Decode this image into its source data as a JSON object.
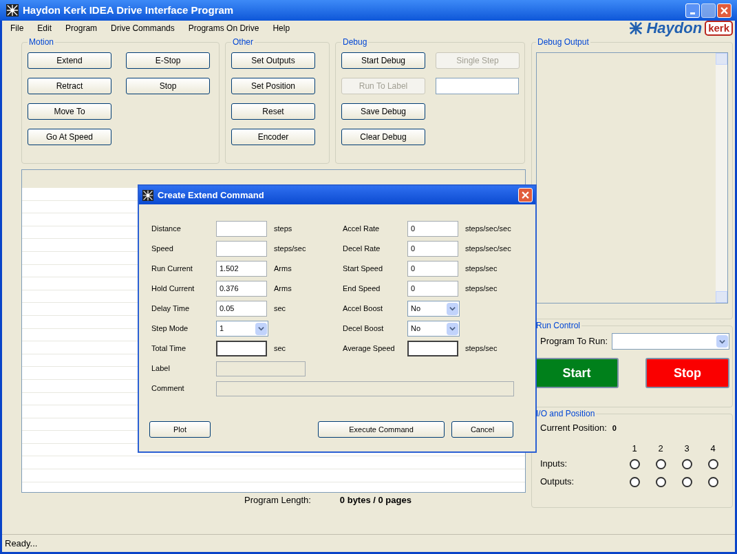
{
  "window": {
    "title": "Haydon Kerk IDEA Drive Interface Program"
  },
  "menu": [
    "File",
    "Edit",
    "Program",
    "Drive Commands",
    "Programs On Drive",
    "Help"
  ],
  "logo": {
    "brand": "Haydon",
    "badge": "kerk"
  },
  "motion": {
    "title": "Motion",
    "buttons": [
      {
        "label": "Extend",
        "disabled": false
      },
      {
        "label": "E-Stop",
        "disabled": false
      },
      {
        "label": "Retract",
        "disabled": false
      },
      {
        "label": "Stop",
        "disabled": false
      },
      {
        "label": "Move To",
        "disabled": false
      },
      {
        "kind": "empty"
      },
      {
        "label": "Go At Speed",
        "disabled": false
      }
    ]
  },
  "other": {
    "title": "Other",
    "buttons": [
      {
        "label": "Set Outputs",
        "disabled": false
      },
      {
        "label": "Set Position",
        "disabled": false
      },
      {
        "label": "Reset",
        "disabled": false
      },
      {
        "label": "Encoder",
        "disabled": false
      }
    ]
  },
  "debug": {
    "title": "Debug",
    "buttons": [
      {
        "label": "Start Debug",
        "disabled": false
      },
      {
        "label": "Single Step",
        "disabled": true
      },
      {
        "label": "Run To Label",
        "disabled": true
      },
      {
        "kind": "field"
      },
      {
        "label": "Save Debug",
        "disabled": false
      },
      {
        "kind": "empty"
      },
      {
        "label": "Clear Debug",
        "disabled": false
      }
    ]
  },
  "program_list": {
    "length_label": "Program Length:",
    "length_value": "0 bytes / 0 pages"
  },
  "debug_output": {
    "title": "Debug Output"
  },
  "run_control": {
    "title": "Run Control",
    "program_label": "Program To Run:",
    "start": "Start",
    "stop": "Stop"
  },
  "io": {
    "title": "I/O and Position",
    "position_label": "Current Position:",
    "position_value": "0",
    "columns": [
      "1",
      "2",
      "3",
      "4"
    ],
    "rows": [
      {
        "label": "Inputs:",
        "lights": [
          {
            "on": false
          },
          {
            "on": false
          },
          {
            "on": false
          },
          {
            "on": false
          }
        ]
      },
      {
        "label": "Outputs:",
        "lights": [
          {
            "on": false
          },
          {
            "on": false
          },
          {
            "on": false
          },
          {
            "on": false
          }
        ]
      }
    ]
  },
  "status_bar": "Ready...",
  "dialog": {
    "title": "Create Extend Command",
    "left": [
      {
        "label": "Distance",
        "kind": "input",
        "unit": "steps"
      },
      {
        "label": "Speed",
        "kind": "input",
        "unit": "steps/sec"
      },
      {
        "label": "Run Current",
        "kind": "input",
        "value": "1.502",
        "unit": "Arms"
      },
      {
        "label": "Hold Current",
        "kind": "input",
        "value": "0.376",
        "unit": "Arms"
      },
      {
        "label": "Delay Time",
        "kind": "input",
        "value": "0.05",
        "unit": "sec"
      },
      {
        "label": "Step Mode",
        "kind": "select",
        "value": "1"
      },
      {
        "label": "Total Time",
        "kind": "result",
        "unit": "sec"
      }
    ],
    "right": [
      {
        "label": "Accel Rate",
        "kind": "input",
        "value": "0",
        "unit": "steps/sec/sec"
      },
      {
        "label": "Decel Rate",
        "kind": "input",
        "value": "0",
        "unit": "steps/sec/sec"
      },
      {
        "label": "Start Speed",
        "kind": "input",
        "value": "0",
        "unit": "steps/sec"
      },
      {
        "label": "End Speed",
        "kind": "input",
        "value": "0",
        "unit": "steps/sec"
      },
      {
        "label": "Accel Boost",
        "kind": "select",
        "value": "No"
      },
      {
        "label": "Decel Boost",
        "kind": "select",
        "value": "No"
      },
      {
        "label": "Average Speed",
        "kind": "result",
        "unit": "steps/sec"
      }
    ],
    "label_field": {
      "label": "Label",
      "disabled": true
    },
    "comment_field": {
      "label": "Comment",
      "disabled": true
    },
    "buttons": [
      "Plot",
      "Execute Command",
      "Cancel"
    ]
  }
}
